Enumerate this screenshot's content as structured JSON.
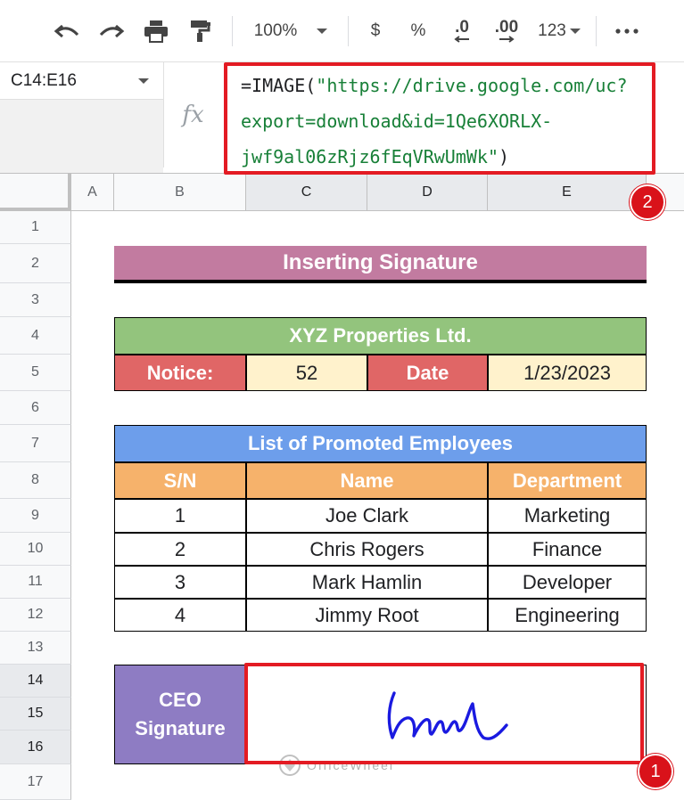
{
  "toolbar": {
    "zoom": "100%",
    "currency": "$",
    "percent": "%",
    "decrease_decimal": ".0",
    "increase_decimal": ".00",
    "more_formats": "123"
  },
  "formula_bar": {
    "name_box": "C14:E16",
    "fx_label": "fx",
    "formula_prefix": "=IMAGE(",
    "formula_string_line1": "\"https://drive.google.com/uc?",
    "formula_string_line2": "export=download&id=1Qe6XORLX-",
    "formula_string_line3": "jwf9al06zRjz6fEqVRwUmWk\"",
    "formula_suffix": ")"
  },
  "columns": [
    "A",
    "B",
    "C",
    "D",
    "E"
  ],
  "rows": [
    "1",
    "2",
    "3",
    "4",
    "5",
    "6",
    "7",
    "8",
    "9",
    "10",
    "11",
    "12",
    "13",
    "14",
    "15",
    "16",
    "17"
  ],
  "sheet": {
    "title": "Inserting Signature",
    "company": "XYZ Properties Ltd.",
    "notice_label": "Notice:",
    "notice_value": "52",
    "date_label": "Date",
    "date_value": "1/23/2023",
    "list_title": "List of Promoted Employees",
    "headers": [
      "S/N",
      "Name",
      "Department"
    ],
    "employees": [
      {
        "sn": "1",
        "name": "Joe Clark",
        "dept": "Marketing"
      },
      {
        "sn": "2",
        "name": "Chris Rogers",
        "dept": "Finance"
      },
      {
        "sn": "3",
        "name": "Mark Hamlin",
        "dept": "Developer"
      },
      {
        "sn": "4",
        "name": "Jimmy Root",
        "dept": "Engineering"
      }
    ],
    "ceo_label_line1": "CEO",
    "ceo_label_line2": "Signature"
  },
  "badges": {
    "one": "1",
    "two": "2"
  },
  "watermark": "OfficeWheel",
  "colors": {
    "title_bg": "#c27ba0",
    "company_bg": "#93c47d",
    "label_red": "#e06666",
    "value_cream": "#fff2cc",
    "list_blue": "#6d9eeb",
    "header_orange": "#f6b26b",
    "ceo_purple": "#8e7cc3",
    "annotation_red": "#e31b23"
  }
}
